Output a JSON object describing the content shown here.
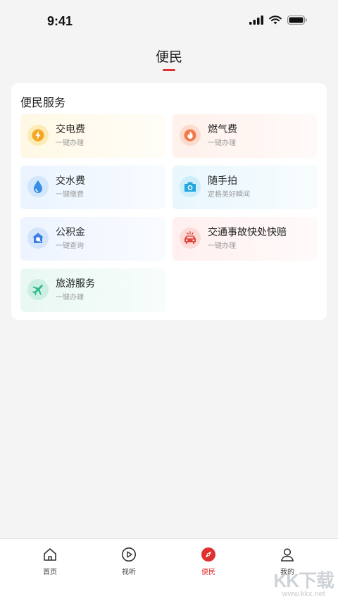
{
  "status_bar": {
    "time": "9:41"
  },
  "nav": {
    "title": "便民"
  },
  "section": {
    "title": "便民服务"
  },
  "services": [
    {
      "title": "交电费",
      "subtitle": "一键办理",
      "icon": "lightning-icon",
      "icon_color": "#f5a623"
    },
    {
      "title": "燃气费",
      "subtitle": "一键办理",
      "icon": "flame-icon",
      "icon_color": "#f07a4a"
    },
    {
      "title": "交水费",
      "subtitle": "一键缴费",
      "icon": "water-drop-icon",
      "icon_color": "#3a8ee6"
    },
    {
      "title": "随手拍",
      "subtitle": "定格美好瞬间",
      "icon": "camera-icon",
      "icon_color": "#22a7e0"
    },
    {
      "title": "公积金",
      "subtitle": "一键查询",
      "icon": "house-fund-icon",
      "icon_color": "#3a7ee6"
    },
    {
      "title": "交通事故快处快赔",
      "subtitle": "一键办理",
      "icon": "car-accident-icon",
      "icon_color": "#e0453a"
    },
    {
      "title": "旅游服务",
      "subtitle": "一键办理",
      "icon": "airplane-icon",
      "icon_color": "#2bb98e"
    }
  ],
  "tabs": [
    {
      "label": "首页",
      "icon": "home-icon"
    },
    {
      "label": "视听",
      "icon": "play-icon"
    },
    {
      "label": "便民",
      "icon": "compass-icon",
      "active": true
    },
    {
      "label": "我的",
      "icon": "user-icon"
    }
  ],
  "watermark": {
    "main": "KK下载",
    "sub": "www.kkx.net"
  },
  "colors": {
    "accent": "#e03131",
    "background": "#f4f4f5"
  }
}
